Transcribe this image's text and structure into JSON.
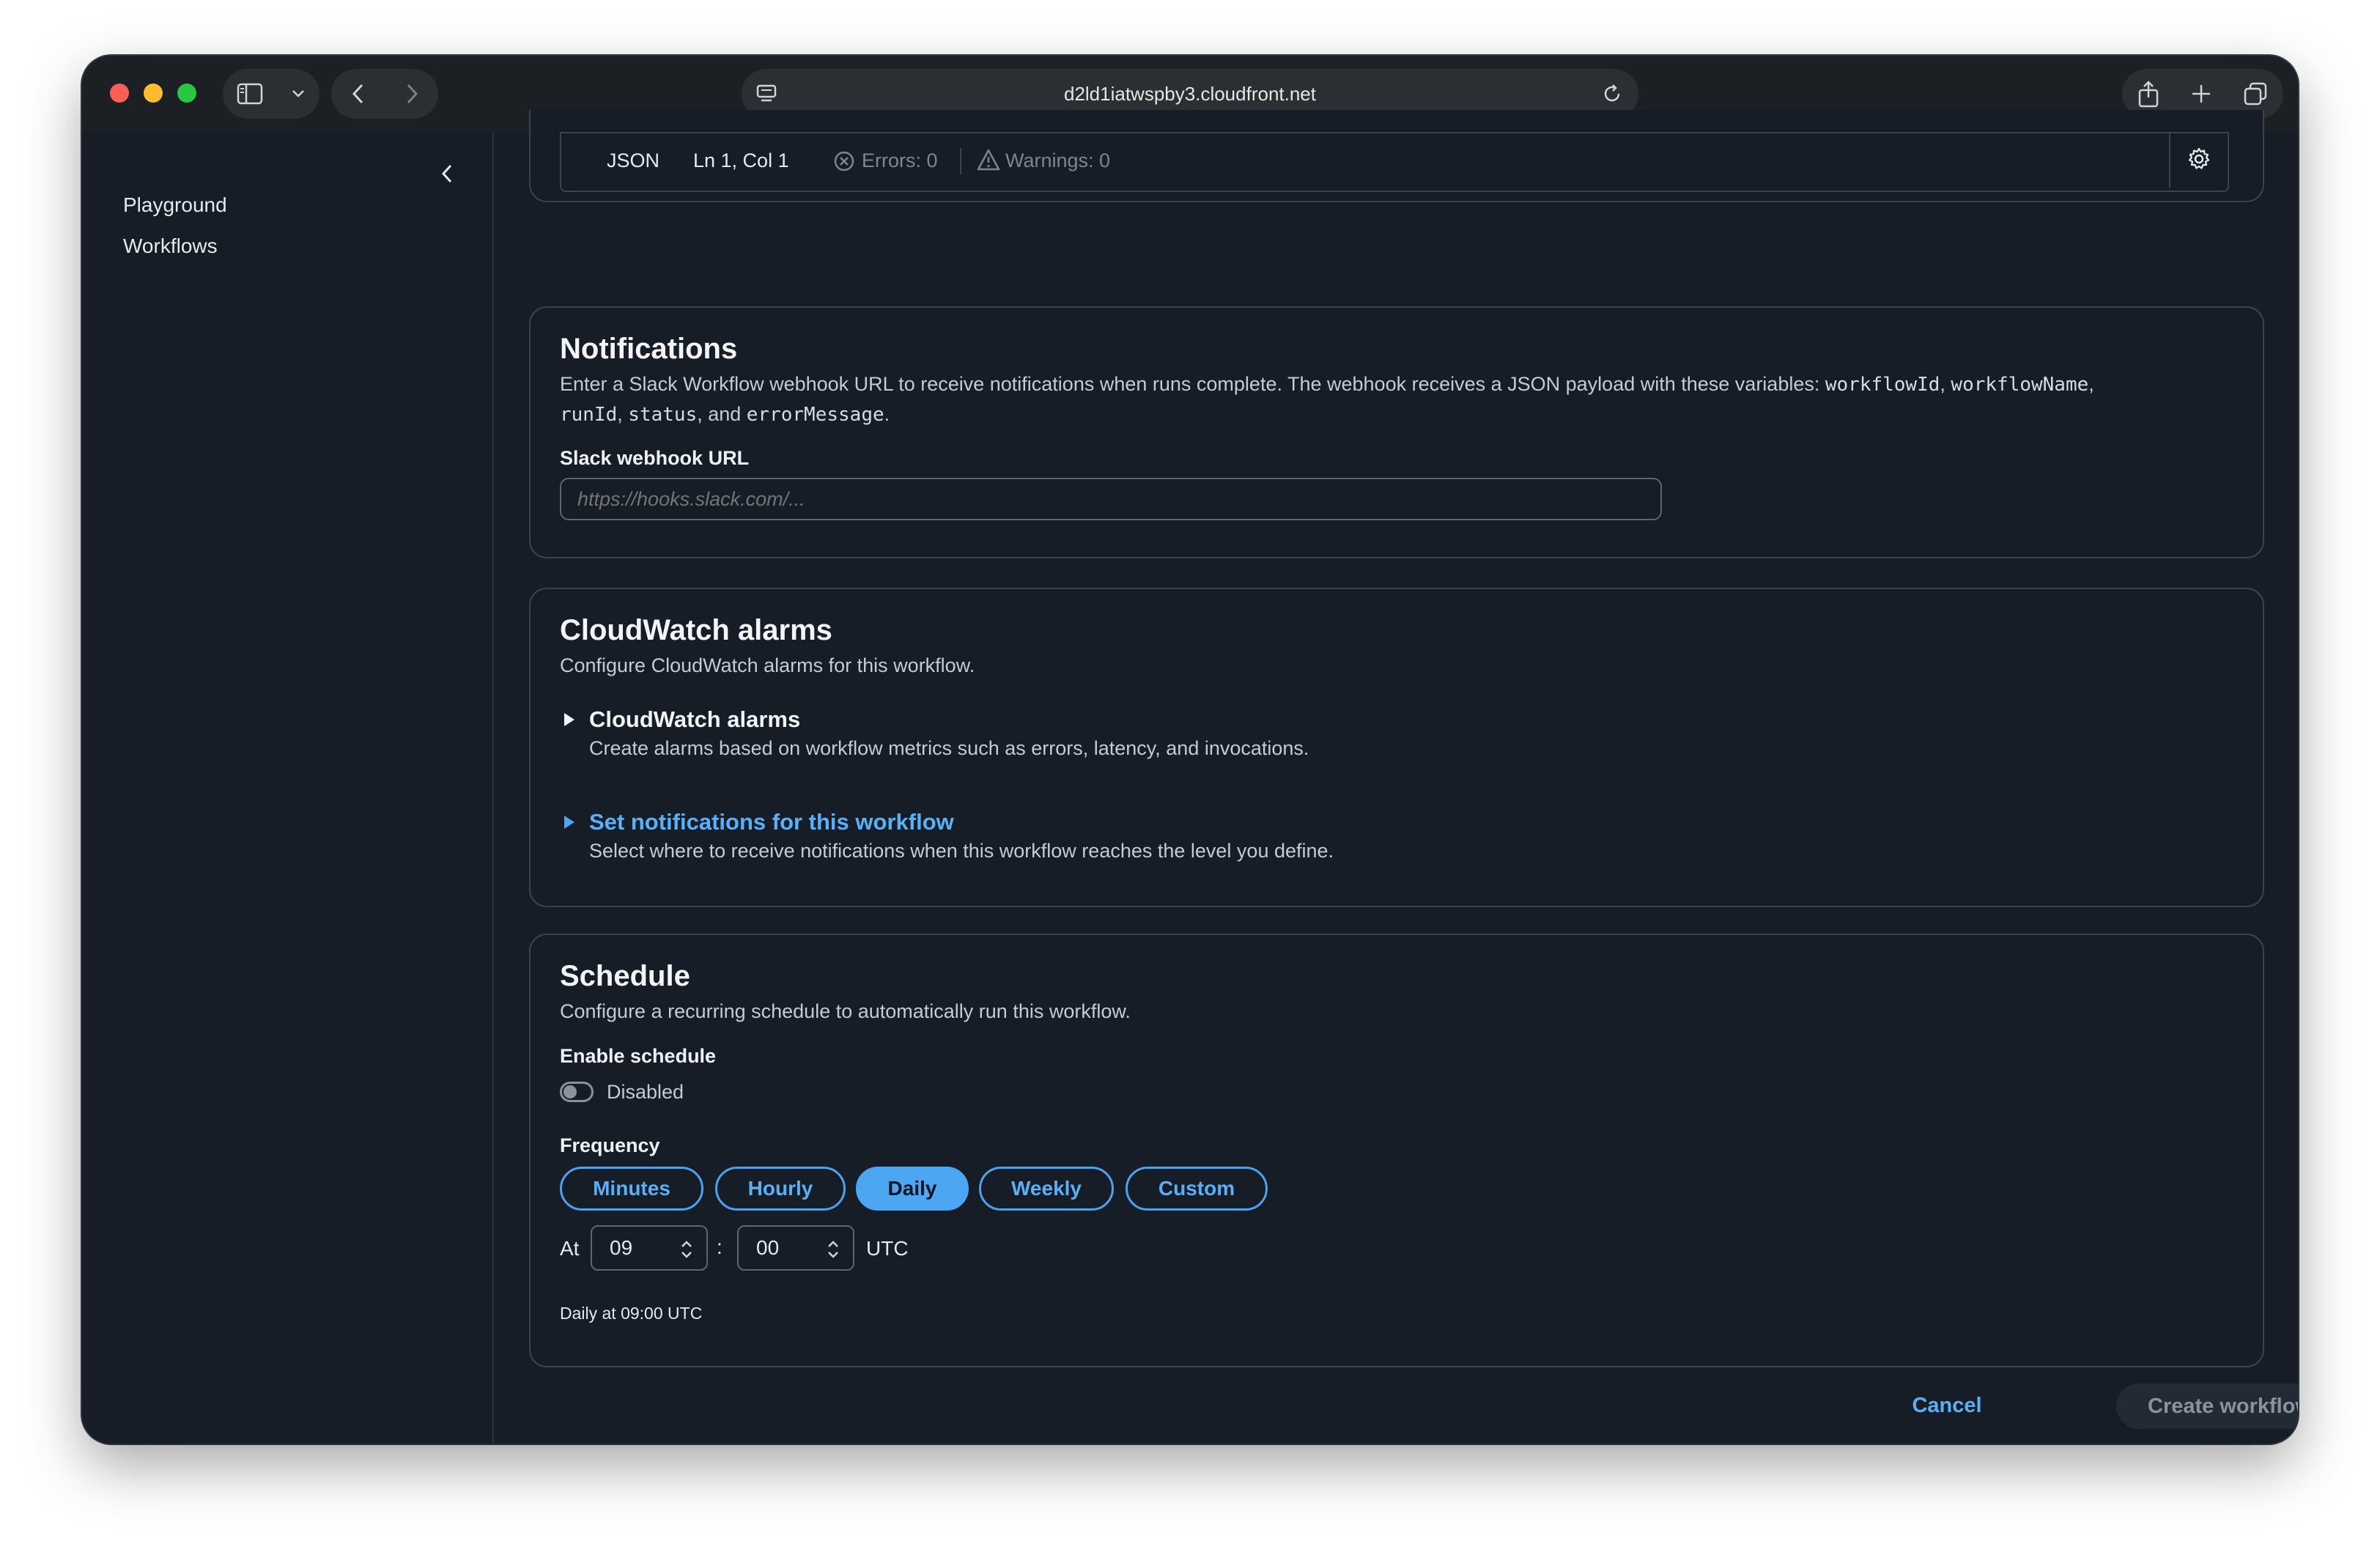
{
  "browser": {
    "url": "d2ld1iatwspby3.cloudfront.net"
  },
  "sidebar": {
    "items": [
      {
        "label": "Playground"
      },
      {
        "label": "Workflows"
      }
    ]
  },
  "editor_status": {
    "language": "JSON",
    "cursor": "Ln 1, Col 1",
    "errors": "Errors: 0",
    "warnings": "Warnings: 0"
  },
  "notifications": {
    "title": "Notifications",
    "desc_part1": "Enter a Slack Workflow webhook URL to receive notifications when runs complete. The webhook receives a JSON payload with these variables: ",
    "var1": "workflowId",
    "sep1": ", ",
    "var2": "workflowName",
    "sep2": ",",
    "var3": "runId",
    "sep3": ", ",
    "var4": "status",
    "sep4": ", and ",
    "var5": "errorMessage",
    "end": ".",
    "field_label": "Slack webhook URL",
    "placeholder": "https://hooks.slack.com/..."
  },
  "cloudwatch": {
    "title": "CloudWatch alarms",
    "desc": "Configure CloudWatch alarms for this workflow.",
    "alarms_title": "CloudWatch alarms",
    "alarms_desc": "Create alarms based on workflow metrics such as errors, latency, and invocations.",
    "notify_title": "Set notifications for this workflow",
    "notify_desc": "Select where to receive notifications when this workflow reaches the level you define."
  },
  "schedule": {
    "title": "Schedule",
    "desc": "Configure a recurring schedule to automatically run this workflow.",
    "enable_label": "Enable schedule",
    "toggle_state": "Disabled",
    "frequency_label": "Frequency",
    "frequencies": [
      "Minutes",
      "Hourly",
      "Daily",
      "Weekly",
      "Custom"
    ],
    "selected_frequency": "Daily",
    "at_label": "At",
    "hour": "09",
    "colon": ":",
    "minute": "00",
    "tz": "UTC",
    "summary": "Daily at 09:00 UTC"
  },
  "footer": {
    "cancel": "Cancel",
    "create": "Create workflow"
  },
  "colors": {
    "accent": "#4ca6f2",
    "background": "#161d27",
    "border": "#3a4350"
  }
}
